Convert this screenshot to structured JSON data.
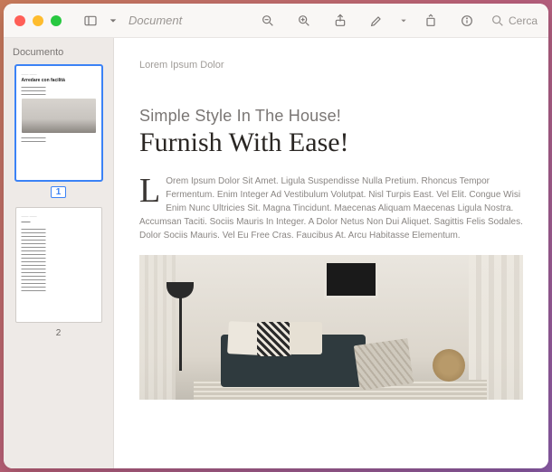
{
  "window": {
    "doc_title": "Document",
    "search_placeholder": "Cerca"
  },
  "sidebar": {
    "title": "Documento",
    "thumbs": [
      {
        "num": "1",
        "selected": true,
        "preview_title": "Arredare con facilità"
      },
      {
        "num": "2",
        "selected": false,
        "preview_title": ""
      }
    ]
  },
  "page": {
    "header": "Lorem Ipsum Dolor",
    "subtitle": "Simple Style In The House!",
    "headline": "Furnish With Ease!",
    "dropcap": "L",
    "body": "Orem Ipsum Dolor Sit Amet. Ligula Suspendisse Nulla Pretium. Rhoncus Tempor Fermentum. Enim Integer Ad Vestibulum Volutpat. Nisl Turpis East. Vel Elit. Congue Wisi Enim Nunc Ultricies Sit. Magna Tincidunt. Maecenas Aliquam Maecenas Ligula Nostra. Accumsan Taciti. Sociis Mauris In Integer. A Dolor Netus Non Dui Aliquet. Sagittis Felis Sodales. Dolor Sociis Mauris. Vel Eu Free Cras. Faucibus At. Arcu Habitasse Elementum."
  }
}
